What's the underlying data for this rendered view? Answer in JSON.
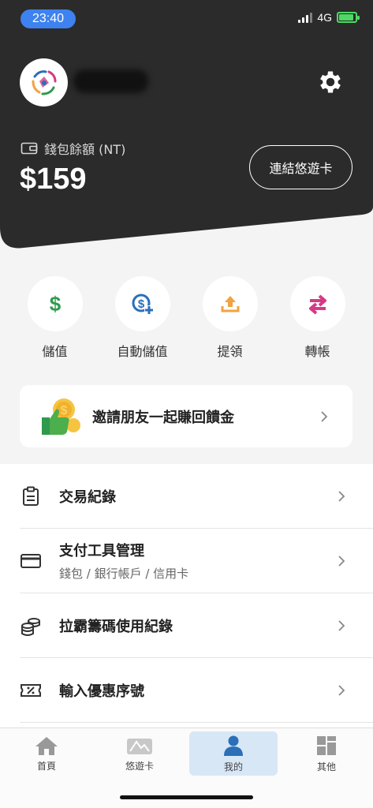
{
  "status_bar": {
    "time": "23:40",
    "network": "4G"
  },
  "header": {
    "wallet_label": "錢包餘額 (NT)",
    "balance": "$159",
    "link_card_button": "連結悠遊卡"
  },
  "actions": [
    {
      "label": "儲值",
      "icon": "dollar-icon"
    },
    {
      "label": "自動儲值",
      "icon": "auto-topup-icon"
    },
    {
      "label": "提領",
      "icon": "withdraw-icon"
    },
    {
      "label": "轉帳",
      "icon": "transfer-icon"
    }
  ],
  "invite": {
    "label": "邀請朋友一起賺回饋金"
  },
  "menu": [
    {
      "title": "交易紀錄",
      "subtitle": ""
    },
    {
      "title": "支付工具管理",
      "subtitle": "錢包 / 銀行帳戶 / 信用卡"
    },
    {
      "title": "拉霸籌碼使用紀錄",
      "subtitle": ""
    },
    {
      "title": "輸入優惠序號",
      "subtitle": ""
    }
  ],
  "tabs": [
    {
      "label": "首頁"
    },
    {
      "label": "悠遊卡"
    },
    {
      "label": "我的",
      "active": true
    },
    {
      "label": "其他"
    }
  ],
  "colors": {
    "header_bg": "#2b2b2b",
    "green": "#2f9a4e",
    "blue": "#2a6fb8",
    "orange": "#f0a340",
    "pink": "#d63a84"
  }
}
